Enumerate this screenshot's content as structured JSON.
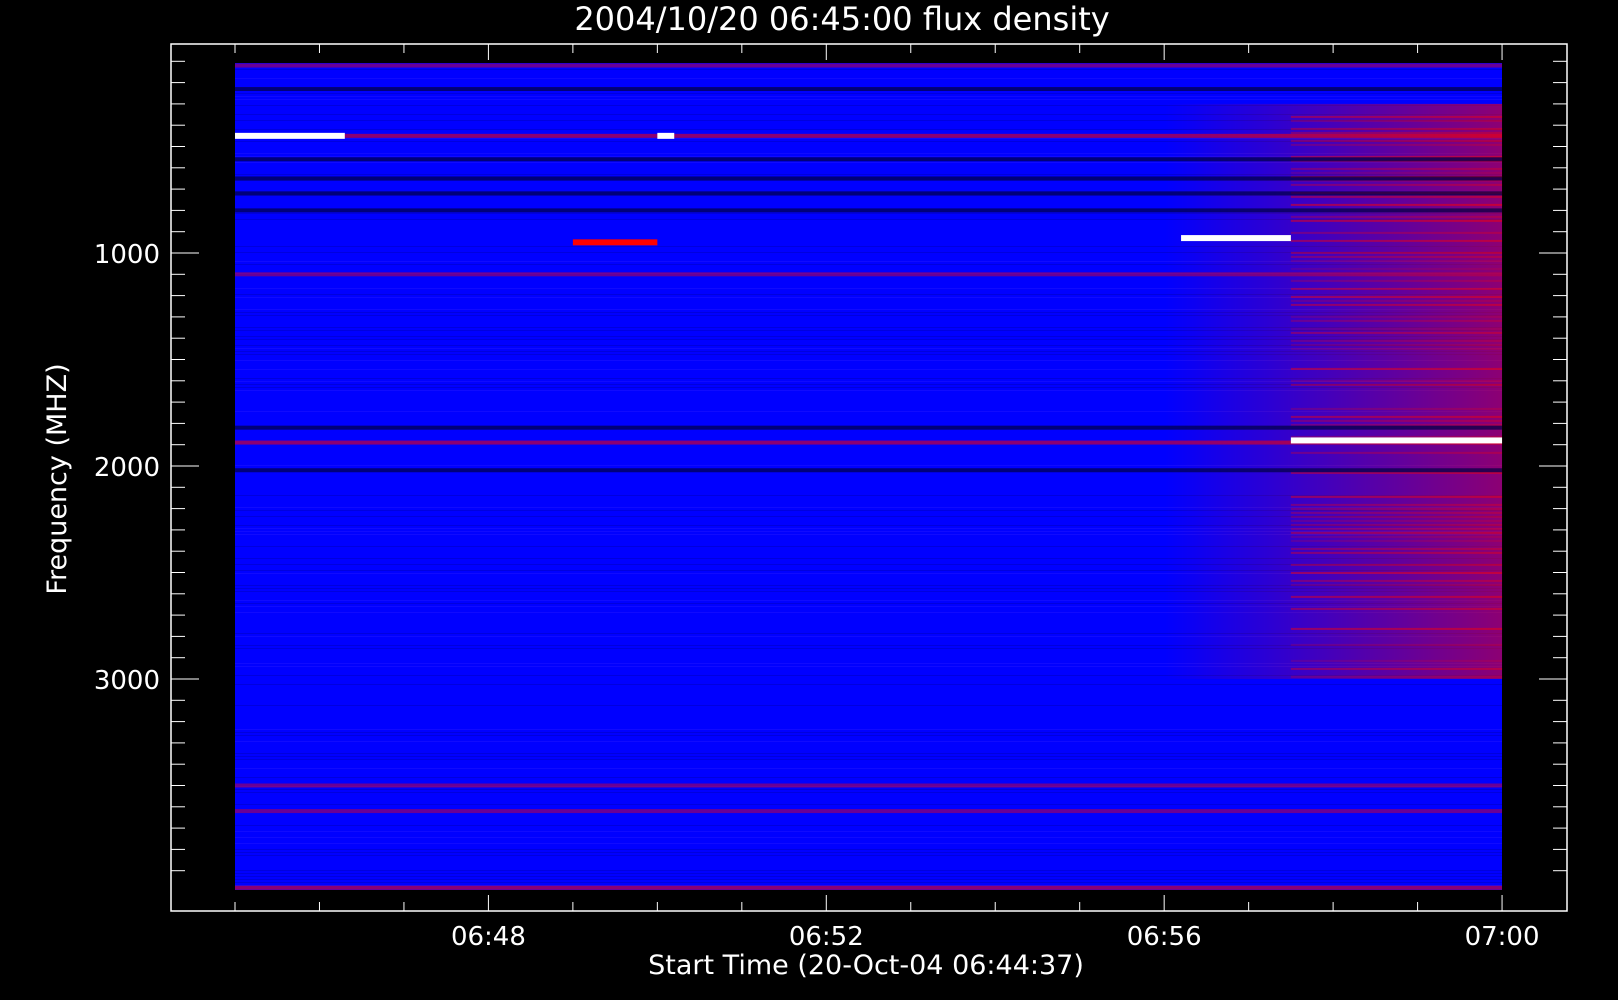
{
  "chart_data": {
    "type": "heatmap",
    "title": "2004/10/20 06:45:00 flux density",
    "xlabel": "Start Time (20-Oct-04 06:44:37)",
    "ylabel": "Frequency (MHZ)",
    "x_tick_labels": [
      "06:48",
      "06:52",
      "06:56",
      "07:00"
    ],
    "x_tick_minutes": [
      48,
      52,
      56,
      60
    ],
    "y_tick_labels": [
      "1000",
      "2000",
      "3000"
    ],
    "y_ticks": [
      1000,
      2000,
      3000
    ],
    "xlim_minutes": [
      45,
      60
    ],
    "ylim": [
      4000,
      100
    ],
    "y_inverted": true,
    "colors": {
      "background": "#0000ff",
      "high": "#ff0000",
      "saturated": "#ffffff",
      "low": "#000020"
    },
    "bands": [
      {
        "freq": 120,
        "level": 0.55
      },
      {
        "freq": 230,
        "level": 0.15
      },
      {
        "freq": 450,
        "level": 0.7
      },
      {
        "freq": 560,
        "level": 0.25
      },
      {
        "freq": 650,
        "level": 0.15
      },
      {
        "freq": 720,
        "level": 0.2
      },
      {
        "freq": 800,
        "level": 0.1
      },
      {
        "freq": 1100,
        "level": 0.35
      },
      {
        "freq": 1820,
        "level": 0.1
      },
      {
        "freq": 1890,
        "level": 0.75
      },
      {
        "freq": 2020,
        "level": 0.2
      },
      {
        "freq": 3500,
        "level": 0.45
      },
      {
        "freq": 3620,
        "level": 0.4
      },
      {
        "freq": 3980,
        "level": 0.6
      }
    ],
    "bursts": [
      {
        "t_start": 45.0,
        "t_end": 46.3,
        "freq": 450,
        "level": 0.9
      },
      {
        "t_start": 50.0,
        "t_end": 50.2,
        "freq": 450,
        "level": 1.0
      },
      {
        "t_start": 49.0,
        "t_end": 50.0,
        "freq": 950,
        "level": 0.8
      },
      {
        "t_start": 56.2,
        "t_end": 57.5,
        "freq": 930,
        "level": 0.95
      },
      {
        "t_start": 57.5,
        "t_end": 60.0,
        "freq": 1880,
        "level": 0.95
      }
    ],
    "enhancement": {
      "t_start": 56.0,
      "t_end": 60.0,
      "freq_min": 300,
      "freq_max": 3000,
      "level": 0.45
    }
  }
}
